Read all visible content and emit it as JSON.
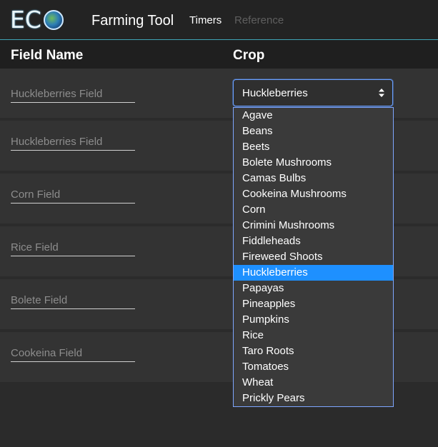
{
  "navbar": {
    "logo_letters": [
      "E",
      "C"
    ],
    "brand": "Farming Tool",
    "links": [
      {
        "label": "Timers",
        "active": true
      },
      {
        "label": "Reference",
        "active": false
      }
    ],
    "accent_color": "#3fa3b5"
  },
  "table": {
    "headers": {
      "field_name": "Field Name",
      "crop": "Crop"
    },
    "rows": [
      {
        "field_placeholder": "Huckleberries Field"
      },
      {
        "field_placeholder": "Huckleberries Field"
      },
      {
        "field_placeholder": "Corn Field"
      },
      {
        "field_placeholder": "Rice Field"
      },
      {
        "field_placeholder": "Bolete Field"
      },
      {
        "field_placeholder": "Cookeina Field"
      }
    ]
  },
  "crop_select": {
    "selected": "Huckleberries",
    "options": [
      "Agave",
      "Beans",
      "Beets",
      "Bolete Mushrooms",
      "Camas Bulbs",
      "Cookeina Mushrooms",
      "Corn",
      "Crimini Mushrooms",
      "Fiddleheads",
      "Fireweed Shoots",
      "Huckleberries",
      "Papayas",
      "Pineapples",
      "Pumpkins",
      "Rice",
      "Taro Roots",
      "Tomatoes",
      "Wheat",
      "Prickly Pears"
    ],
    "highlight_color": "#1e90ff"
  }
}
